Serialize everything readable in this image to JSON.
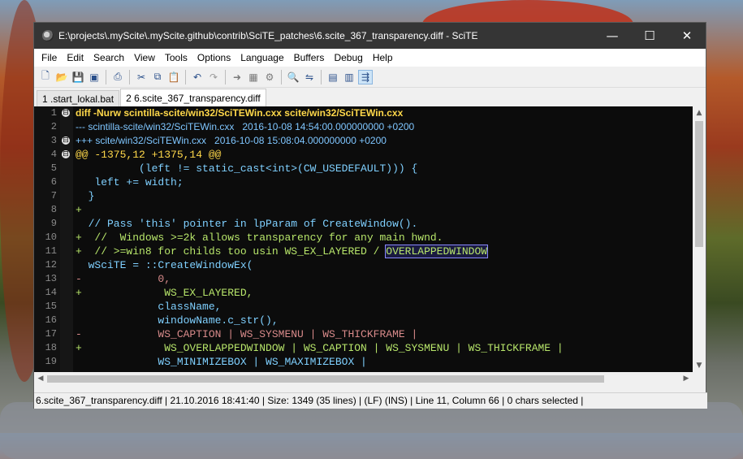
{
  "window": {
    "title": "E:\\projects\\.myScite\\.myScite.github\\contrib\\SciTE_patches\\6.scite_367_transparency.diff - SciTE",
    "minimize": "—",
    "maximize": "☐",
    "close": "✕"
  },
  "menu": [
    "File",
    "Edit",
    "Search",
    "View",
    "Tools",
    "Options",
    "Language",
    "Buffers",
    "Debug",
    "Help"
  ],
  "tabs": [
    "1 .start_lokal.bat",
    "2 6.scite_367_transparency.diff"
  ],
  "toolbar_icons": [
    "new-file-icon",
    "open-file-icon",
    "save-icon",
    "save-all-icon",
    "print-icon",
    "cut-icon",
    "copy-icon",
    "paste-icon",
    "undo-icon",
    "redo-icon",
    "compile-icon",
    "build-icon",
    "go-icon",
    "stop-icon",
    "find-icon",
    "replace-icon",
    "wrap-icon",
    "toggle-output-icon",
    "toggle-toolbar-icon"
  ],
  "lines": [
    {
      "n": "1",
      "fold": "⊟",
      "cls": "c-head",
      "text": "diff -Nurw scintilla-scite/win32/SciTEWin.cxx scite/win32/SciTEWin.cxx"
    },
    {
      "n": "2",
      "fold": "",
      "cls": "c-minus",
      "text": "--- scintilla-scite/win32/SciTEWin.cxx   2016-10-08 14:54:00.000000000 +0200"
    },
    {
      "n": "3",
      "fold": "⊟",
      "cls": "c-plus",
      "text": "+++ scite/win32/SciTEWin.cxx   2016-10-08 15:08:04.000000000 +0200"
    },
    {
      "n": "4",
      "fold": "⊟",
      "cls": "c-hunk",
      "text": "@@ -1375,12 +1375,14 @@"
    },
    {
      "n": "5",
      "fold": "",
      "cls": "c-norm",
      "text": "          (left != static_cast<int>(CW_USEDEFAULT))) {"
    },
    {
      "n": "6",
      "fold": "",
      "cls": "c-norm",
      "text": "   left += width;"
    },
    {
      "n": "7",
      "fold": "",
      "cls": "c-norm",
      "text": "  }"
    },
    {
      "n": "8",
      "fold": "",
      "cls": "c-add",
      "text": "+"
    },
    {
      "n": "9",
      "fold": "",
      "cls": "c-norm",
      "text": "  // Pass 'this' pointer in lpParam of CreateWindow()."
    },
    {
      "n": "10",
      "fold": "",
      "cls": "c-add",
      "text": "+  //  Windows >=2k allows transparency for any main hwnd."
    },
    {
      "n": "11",
      "fold": "",
      "cls": "c-add",
      "text": "+  // >=win8 for childs too usin WS_EX_LAYERED / ",
      "hl": "OVERLAPPEDWINDOW"
    },
    {
      "n": "12",
      "fold": "",
      "cls": "c-norm",
      "text": "  wSciTE = ::CreateWindowEx("
    },
    {
      "n": "13",
      "fold": "",
      "cls": "c-del",
      "text": "-            0,"
    },
    {
      "n": "14",
      "fold": "",
      "cls": "c-add",
      "text": "+             WS_EX_LAYERED,"
    },
    {
      "n": "15",
      "fold": "",
      "cls": "c-norm",
      "text": "             className,"
    },
    {
      "n": "16",
      "fold": "",
      "cls": "c-norm",
      "text": "             windowName.c_str(),"
    },
    {
      "n": "17",
      "fold": "",
      "cls": "c-del",
      "text": "-            WS_CAPTION | WS_SYSMENU | WS_THICKFRAME |"
    },
    {
      "n": "18",
      "fold": "",
      "cls": "c-add",
      "text": "+             WS_OVERLAPPEDWINDOW | WS_CAPTION | WS_SYSMENU | WS_THICKFRAME |"
    },
    {
      "n": "19",
      "fold": "",
      "cls": "c-norm",
      "text": "             WS_MINIMIZEBOX | WS_MAXIMIZEBOX |"
    }
  ],
  "status": "6.scite_367_transparency.diff | 21.10.2016 18:41:40  |  Size: 1349 (35 lines)  |  (LF)  (INS)  |  Line 11, Column 66  |  0 chars selected  |"
}
